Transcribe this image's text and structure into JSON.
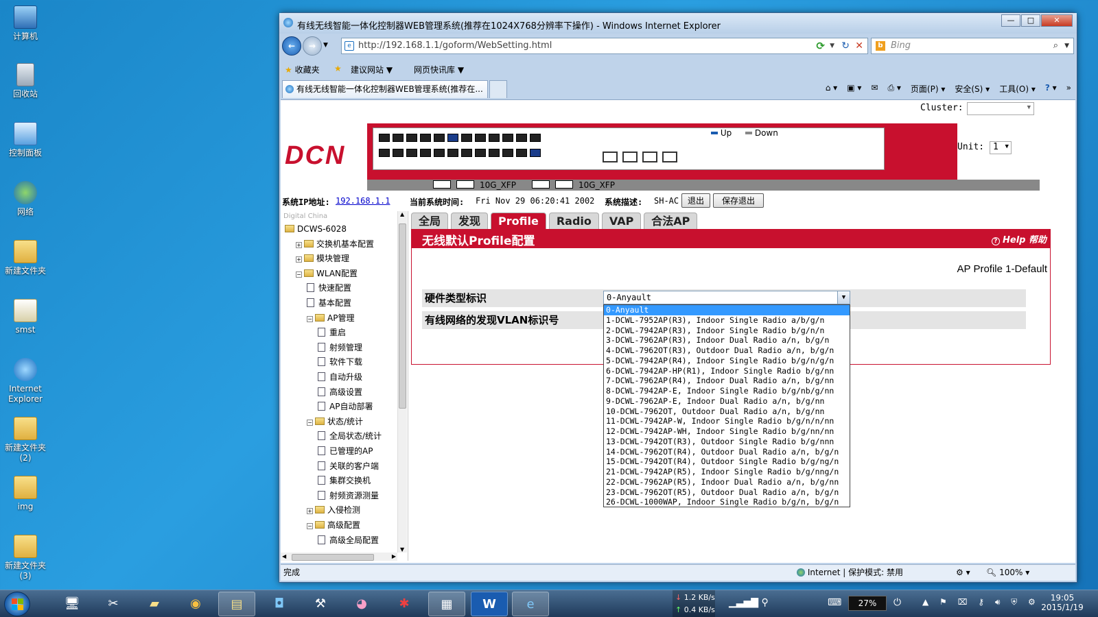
{
  "desktop": {
    "icons": [
      {
        "label": "计算机",
        "icon": "computer-icon"
      },
      {
        "label": "回收站",
        "icon": "recycle-bin-icon"
      },
      {
        "label": "控制面板",
        "icon": "control-panel-icon"
      },
      {
        "label": "网络",
        "icon": "network-icon"
      },
      {
        "label": "新建文件夹",
        "icon": "folder-icon"
      },
      {
        "label": "smst",
        "icon": "document-icon"
      },
      {
        "label": "Internet Explorer",
        "icon": "internet-explorer-icon"
      },
      {
        "label": "新建文件夹 (2)",
        "icon": "folder-icon"
      },
      {
        "label": "img",
        "icon": "folder-icon"
      },
      {
        "label": "新建文件夹 (3)",
        "icon": "folder-icon"
      }
    ]
  },
  "window": {
    "title": "有线无线智能一体化控制器WEB管理系统(推荐在1024X768分辨率下操作) - Windows Internet Explorer",
    "address": "http://192.168.1.1/goform/WebSetting.html",
    "search_placeholder": "Bing",
    "favorites_label": "收藏夹",
    "suggested_sites": "建议网站",
    "web_slice": "网页快讯库",
    "tab_title": "有线无线智能一体化控制器WEB管理系统(推荐在...",
    "cmd_page": "页面(P)",
    "cmd_safety": "安全(S)",
    "cmd_tools": "工具(O)",
    "status_left": "完成",
    "status_zone": "Internet | 保护模式: 禁用",
    "zoom": "100%"
  },
  "page": {
    "cluster_label": "Cluster:",
    "unit_label": "Unit:",
    "unit_value": "1",
    "legend_up": "Up",
    "legend_down": "Down",
    "xfp1": "10G_XFP",
    "xfp2": "10G_XFP",
    "logo": "DCN",
    "sys_ip_label": "系统IP地址:",
    "sys_ip": "192.168.1.1",
    "sys_time_label": "当前系统时间:",
    "sys_time": "Fri Nov 29 06:20:41 2002",
    "sys_desc_label": "系统描述:",
    "sys_desc": "SH-AC",
    "logout": "退出",
    "save_logout": "保存退出",
    "tree_caption": "Digital China",
    "tree": [
      {
        "label": "DCWS-6028",
        "depth": 0,
        "kind": "folder",
        "pm": ""
      },
      {
        "label": "交换机基本配置",
        "depth": 1,
        "kind": "folder",
        "pm": "+"
      },
      {
        "label": "模块管理",
        "depth": 1,
        "kind": "folder",
        "pm": "+"
      },
      {
        "label": "WLAN配置",
        "depth": 1,
        "kind": "folder",
        "pm": "-"
      },
      {
        "label": "快速配置",
        "depth": 2,
        "kind": "page",
        "pm": ""
      },
      {
        "label": "基本配置",
        "depth": 2,
        "kind": "page",
        "pm": ""
      },
      {
        "label": "AP管理",
        "depth": 2,
        "kind": "folder",
        "pm": "-"
      },
      {
        "label": "重启",
        "depth": 3,
        "kind": "page",
        "pm": ""
      },
      {
        "label": "射频管理",
        "depth": 3,
        "kind": "page",
        "pm": ""
      },
      {
        "label": "软件下载",
        "depth": 3,
        "kind": "page",
        "pm": ""
      },
      {
        "label": "自动升级",
        "depth": 3,
        "kind": "page",
        "pm": ""
      },
      {
        "label": "高级设置",
        "depth": 3,
        "kind": "page",
        "pm": ""
      },
      {
        "label": "AP自动部署",
        "depth": 3,
        "kind": "page",
        "pm": ""
      },
      {
        "label": "状态/统计",
        "depth": 2,
        "kind": "folder",
        "pm": "-"
      },
      {
        "label": "全局状态/统计",
        "depth": 3,
        "kind": "page",
        "pm": ""
      },
      {
        "label": "已管理的AP",
        "depth": 3,
        "kind": "page",
        "pm": ""
      },
      {
        "label": "关联的客户端",
        "depth": 3,
        "kind": "page",
        "pm": ""
      },
      {
        "label": "集群交换机",
        "depth": 3,
        "kind": "page",
        "pm": ""
      },
      {
        "label": "射频资源测量",
        "depth": 3,
        "kind": "page",
        "pm": ""
      },
      {
        "label": "入侵检测",
        "depth": 2,
        "kind": "folder",
        "pm": "+"
      },
      {
        "label": "高级配置",
        "depth": 2,
        "kind": "folder",
        "pm": "-"
      },
      {
        "label": "高级全局配置",
        "depth": 3,
        "kind": "page",
        "pm": ""
      }
    ],
    "tabs": [
      "全局",
      "发现",
      "Profile",
      "Radio",
      "VAP",
      "合法AP"
    ],
    "active_tab": "Profile",
    "panel_title": "无线默认Profile配置",
    "help": "Help 帮助",
    "profile_name": "AP Profile 1-Default",
    "field1_label": "硬件类型标识",
    "field2_label": "有线网络的发现VLAN标识号",
    "select_value": "0-Anyault",
    "options": [
      "0-Anyault",
      "1-DCWL-7952AP(R3), Indoor Single Radio a/b/g/n",
      "2-DCWL-7942AP(R3), Indoor Single Radio b/g/n/n",
      "3-DCWL-7962AP(R3), Indoor Dual Radio a/n, b/g/n",
      "4-DCWL-7962OT(R3), Outdoor Dual Radio a/n, b/g/n",
      "5-DCWL-7942AP(R4), Indoor Single Radio b/g/n/g/n",
      "6-DCWL-7942AP-HP(R1), Indoor Single Radio b/g/nn",
      "7-DCWL-7962AP(R4), Indoor Dual Radio a/n, b/g/nn",
      "8-DCWL-7942AP-E, Indoor Single Radio b/g/nb/g/nn",
      "9-DCWL-7962AP-E, Indoor Dual Radio a/n, b/g/nn",
      "10-DCWL-7962OT, Outdoor Dual Radio a/n, b/g/nn",
      "11-DCWL-7942AP-W, Indoor Single Radio b/g/n/n/nn",
      "12-DCWL-7942AP-WH, Indoor Single Radio b/g/nn/nn",
      "13-DCWL-7942OT(R3), Outdoor Single Radio b/g/nnn",
      "14-DCWL-7962OT(R4), Outdoor Dual Radio a/n, b/g/n",
      "15-DCWL-7942OT(R4), Outdoor Single Radio b/g/ng/n",
      "21-DCWL-7942AP(R5), Indoor Single Radio b/g/nng/n",
      "22-DCWL-7962AP(R5), Indoor Dual Radio a/n, b/g/nn",
      "23-DCWL-7962OT(R5), Outdoor Dual Radio a/n, b/g/n",
      "26-DCWL-1000WAP, Indoor Single Radio b/g/n, b/g/n"
    ]
  },
  "taskbar": {
    "net_down": "1.2 KB/s",
    "net_up": "0.4 KB/s",
    "battery": "27%",
    "time": "19:05",
    "date": "2015/1/19"
  },
  "colors": {
    "brand_red": "#c8102e",
    "select_blue": "#3399ff"
  }
}
